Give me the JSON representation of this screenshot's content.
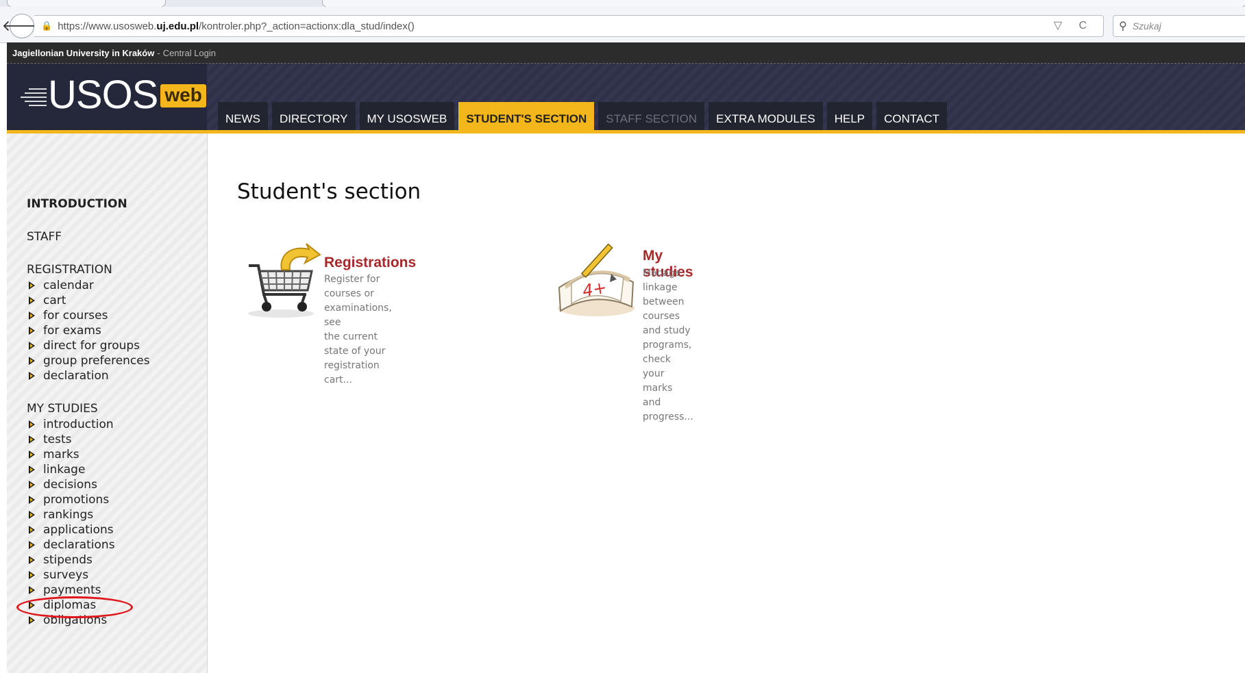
{
  "browser": {
    "url_prefix": "https://www.usosweb.",
    "url_domain": "uj.edu.pl",
    "url_rest": "/kontroler.php?_action=actionx:dla_stud/index()",
    "search_placeholder": "Szukaj",
    "back_glyph": "🡐",
    "lock_glyph": "🔒",
    "controls_glyph": "▽ C",
    "search_glyph": "⚲"
  },
  "topbar": {
    "university": "Jagiellonian University in Kraków",
    "separator": "-",
    "login": "Central Login"
  },
  "logo": {
    "usos": "USOS",
    "web": "web"
  },
  "nav": {
    "tabs": [
      {
        "label": "NEWS"
      },
      {
        "label": "DIRECTORY"
      },
      {
        "label": "MY USOSWEB"
      },
      {
        "label": "STUDENT'S SECTION"
      },
      {
        "label": "STAFF SECTION"
      },
      {
        "label": "EXTRA MODULES"
      },
      {
        "label": "HELP"
      },
      {
        "label": "CONTACT"
      }
    ],
    "active": "STUDENT'S SECTION",
    "disabled": "STAFF SECTION"
  },
  "sidebar": {
    "introduction": "INTRODUCTION",
    "staff": "STAFF",
    "registration": {
      "heading": "REGISTRATION",
      "items": [
        "calendar",
        "cart",
        "for courses",
        "for exams",
        "direct for groups",
        "group preferences",
        "declaration"
      ]
    },
    "my_studies": {
      "heading": "MY STUDIES",
      "items": [
        "introduction",
        "tests",
        "marks",
        "linkage",
        "decisions",
        "promotions",
        "rankings",
        "applications",
        "declarations",
        "stipends",
        "surveys",
        "payments",
        "diplomas",
        "obligations"
      ]
    }
  },
  "main": {
    "title": "Student's section",
    "cards": [
      {
        "title": "Registrations",
        "desc_line1": "Register for courses or examinations, see",
        "desc_line2": "the current state of your registration cart...",
        "icon": "shopping-cart-icon"
      },
      {
        "title": "My studies",
        "desc_line1": "Manage linkage between courses and study",
        "desc_line2": "programs, check your marks and",
        "desc_line3": "progress...",
        "icon": "notebook-pencil-icon",
        "mark": "4+"
      }
    ]
  },
  "colors": {
    "accent": "#f3b71c",
    "card_title": "#a8282a",
    "annotation": "#e0161c"
  }
}
